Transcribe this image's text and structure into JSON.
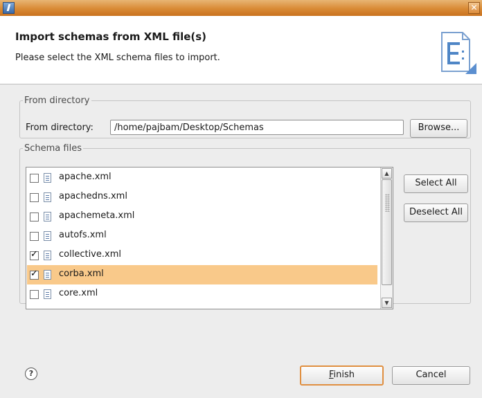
{
  "window": {
    "close_symbol": "✕"
  },
  "banner": {
    "title": "Import schemas from XML file(s)",
    "description": "Please select the XML schema files to import.",
    "icon": "schema-file-wizard-icon"
  },
  "from_directory_group": {
    "legend": "From directory",
    "label": "From directory:",
    "value": "/home/pajbam/Desktop/Schemas",
    "browse_label": "Browse..."
  },
  "schema_files_group": {
    "legend": "Schema files",
    "items": [
      {
        "label": "apache.xml",
        "checked": false,
        "selected": false
      },
      {
        "label": "apachedns.xml",
        "checked": false,
        "selected": false
      },
      {
        "label": "apachemeta.xml",
        "checked": false,
        "selected": false
      },
      {
        "label": "autofs.xml",
        "checked": false,
        "selected": false
      },
      {
        "label": "collective.xml",
        "checked": true,
        "selected": false
      },
      {
        "label": "corba.xml",
        "checked": true,
        "selected": true
      },
      {
        "label": "core.xml",
        "checked": false,
        "selected": false
      }
    ],
    "select_all_label": "Select All",
    "deselect_all_label": "Deselect All"
  },
  "footer": {
    "help_symbol": "?",
    "finish_mnemonic": "F",
    "finish_rest": "inish",
    "cancel_label": "Cancel"
  },
  "colors": {
    "selection": "#f9c98a",
    "titlebar": "#d98a35",
    "default_button_border": "#e08f40"
  }
}
